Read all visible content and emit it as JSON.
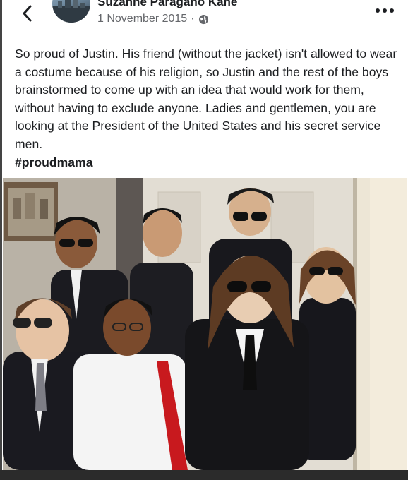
{
  "post": {
    "author": "Suzanne Paragano Kane",
    "date": "1 November 2015",
    "separator": "·",
    "audience_icon": "globe-icon",
    "body": "So proud of Justin. His friend (without the jacket) isn't allowed to wear a costume because of his religion, so Justin and the rest of the boys brainstormed to come up with an idea that would work for them, without having to exclude anyone. Ladies and gentlemen, you are looking at the President of the United States and his secret service men.",
    "hashtag": "#proudmama"
  },
  "icons": {
    "back": "chevron-left-icon",
    "more": "more-dots-icon"
  },
  "colors": {
    "text": "#1c1e21",
    "secondary_text": "#65676b",
    "background": "#ffffff"
  }
}
